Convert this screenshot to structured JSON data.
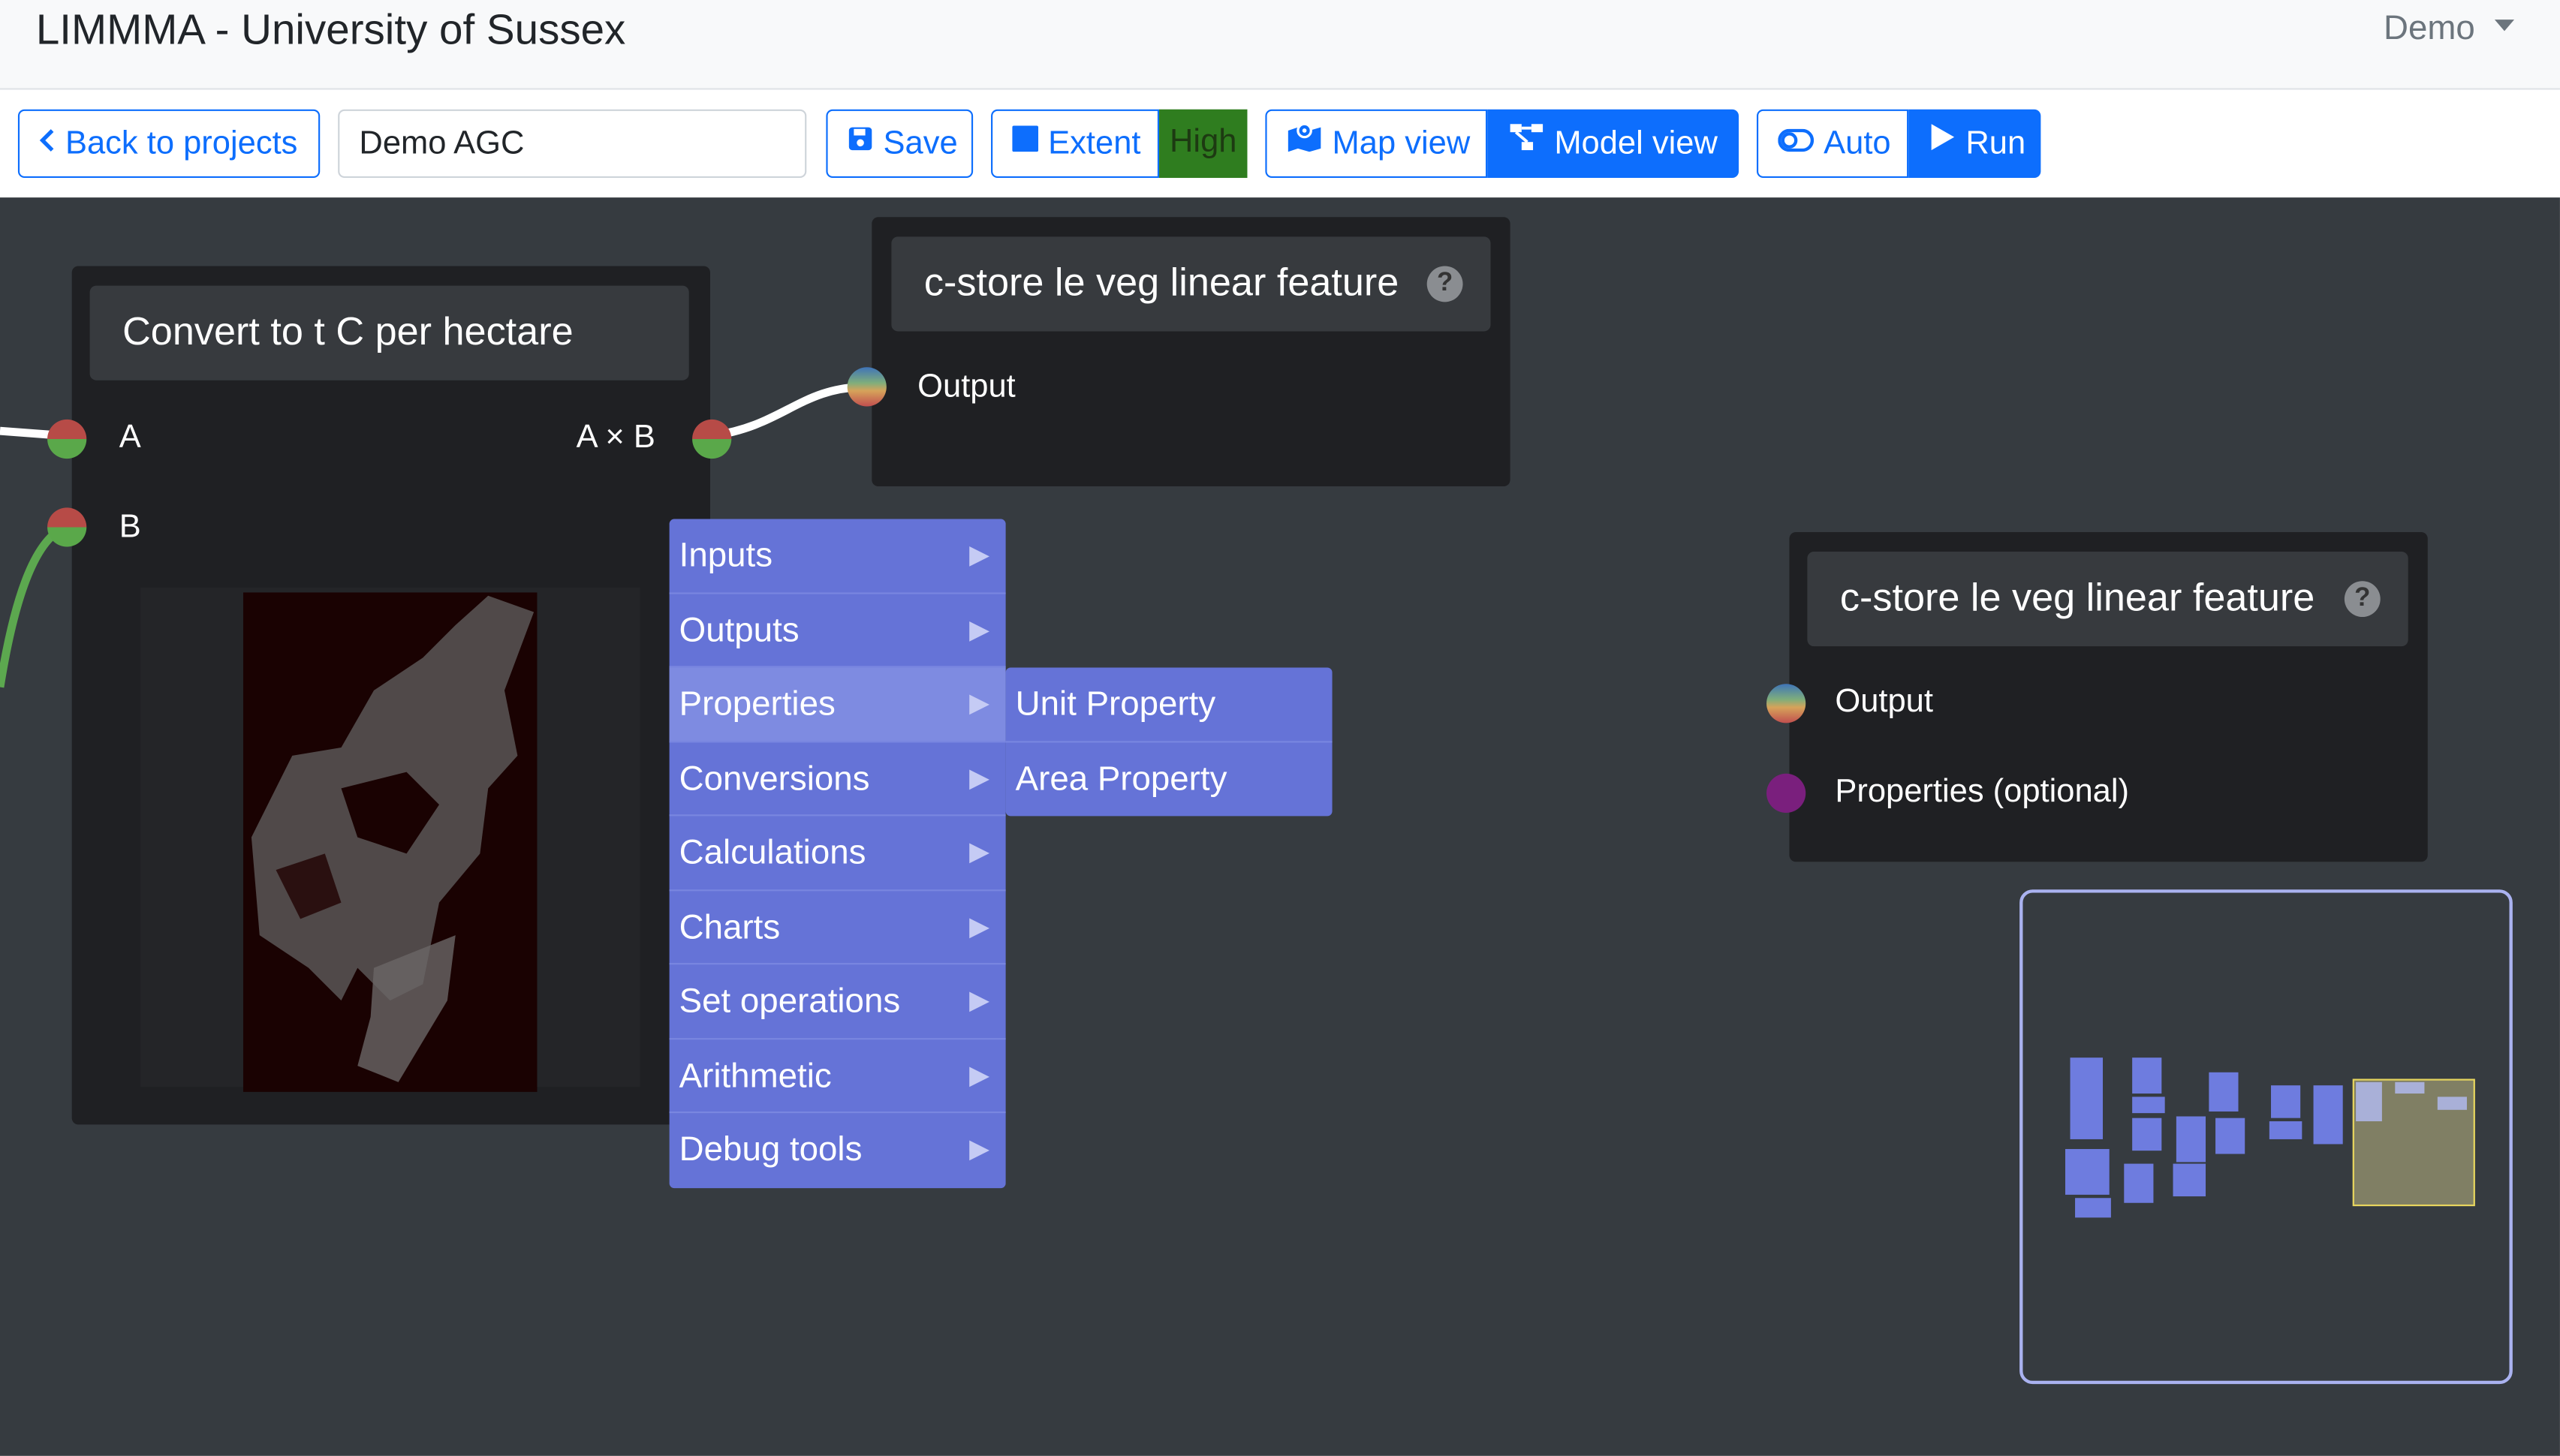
{
  "app": {
    "title": "LIMMMA - University of Sussex",
    "user": "Demo"
  },
  "toolbar": {
    "back_label": "Back to projects",
    "project_name": "Demo AGC",
    "save_label": "Save",
    "extent_label": "Extent",
    "resolution_badge": "High",
    "map_view_label": "Map view",
    "model_view_label": "Model view",
    "auto_label": "Auto",
    "run_label": "Run"
  },
  "nodes": [
    {
      "title": "Convert to t C per hectare",
      "inputs": [
        "A",
        "B"
      ],
      "output": "A × B"
    },
    {
      "title": "c-store le veg linear feature",
      "outputs": [
        "Output"
      ]
    },
    {
      "title": "c-store le veg linear feature",
      "outputs": [
        "Output",
        "Properties (optional)"
      ]
    }
  ],
  "context_menu": {
    "items": [
      "Inputs",
      "Outputs",
      "Properties",
      "Conversions",
      "Calculations",
      "Charts",
      "Set operations",
      "Arithmetic",
      "Debug tools"
    ],
    "active": "Properties",
    "submenu": [
      "Unit Property",
      "Area Property"
    ]
  },
  "colors": {
    "primary": "#0d6efd",
    "canvas": "#363b40",
    "menu": "#6573d7",
    "badge_high": "#2f7d1f"
  },
  "icons": [
    "chevron-left-icon",
    "save-icon",
    "square-icon",
    "map-icon",
    "graph-icon",
    "toggle-icon",
    "play-icon",
    "help-icon",
    "caret-right-icon"
  ]
}
